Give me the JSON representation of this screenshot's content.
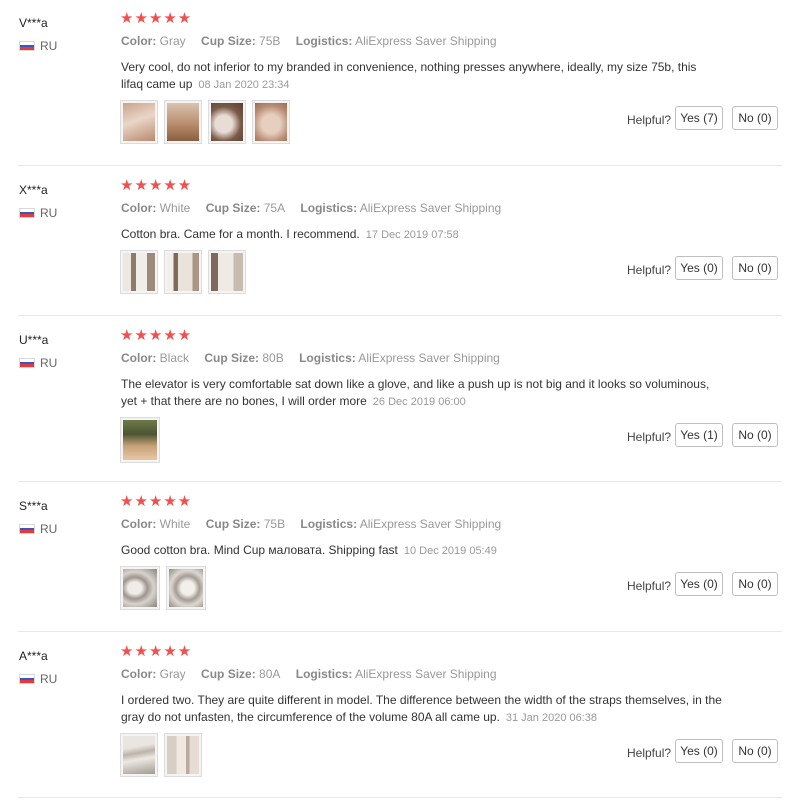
{
  "labels": {
    "color": "Color:",
    "cup_size": "Cup Size:",
    "logistics": "Logistics:",
    "helpful": "Helpful?"
  },
  "reviews": [
    {
      "user": "V***a",
      "country": "RU",
      "stars": "★★★★★",
      "rating": 5,
      "color": "Gray",
      "cup_size": "75B",
      "logistics": "AliExpress Saver Shipping",
      "text": "Very cool, do not inferior to my branded in convenience, nothing presses anywhere, ideally, my size 75b, this lifaq came up",
      "date": "08 Jan 2020 23:34",
      "photo_count": 4,
      "yes": "Yes (7)",
      "no": "No (0)"
    },
    {
      "user": "X***a",
      "country": "RU",
      "stars": "★★★★★",
      "rating": 5,
      "color": "White",
      "cup_size": "75A",
      "logistics": "AliExpress Saver Shipping",
      "text": "Cotton bra. Came for a month. I recommend.",
      "date": "17 Dec 2019 07:58",
      "photo_count": 3,
      "yes": "Yes (0)",
      "no": "No (0)"
    },
    {
      "user": "U***a",
      "country": "RU",
      "stars": "★★★★★",
      "rating": 5,
      "color": "Black",
      "cup_size": "80B",
      "logistics": "AliExpress Saver Shipping",
      "text": "The elevator is very comfortable sat down like a glove, and like a push up is not big and it looks so voluminous, yet + that there are no bones, I will order more",
      "date": "26 Dec 2019 06:00",
      "photo_count": 1,
      "yes": "Yes (1)",
      "no": "No (0)"
    },
    {
      "user": "S***a",
      "country": "RU",
      "stars": "★★★★★",
      "rating": 5,
      "color": "White",
      "cup_size": "75B",
      "logistics": "AliExpress Saver Shipping",
      "text": "Good cotton bra. Mind Cup маловата. Shipping fast",
      "date": "10 Dec 2019 05:49",
      "photo_count": 2,
      "yes": "Yes (0)",
      "no": "No (0)"
    },
    {
      "user": "A***a",
      "country": "RU",
      "stars": "★★★★★",
      "rating": 5,
      "color": "Gray",
      "cup_size": "80A",
      "logistics": "AliExpress Saver Shipping",
      "text": "I ordered two. They are quite different in model. The difference between the width of the straps themselves, in the gray do not unfasten, the circumference of the volume 80A all came up.",
      "date": "31 Jan 2020 06:38",
      "photo_count": 2,
      "yes": "Yes (0)",
      "no": "No (0)"
    }
  ],
  "colors": {
    "star": "#f24f4f",
    "divider": "#e8e8e8",
    "muted": "#999999"
  }
}
